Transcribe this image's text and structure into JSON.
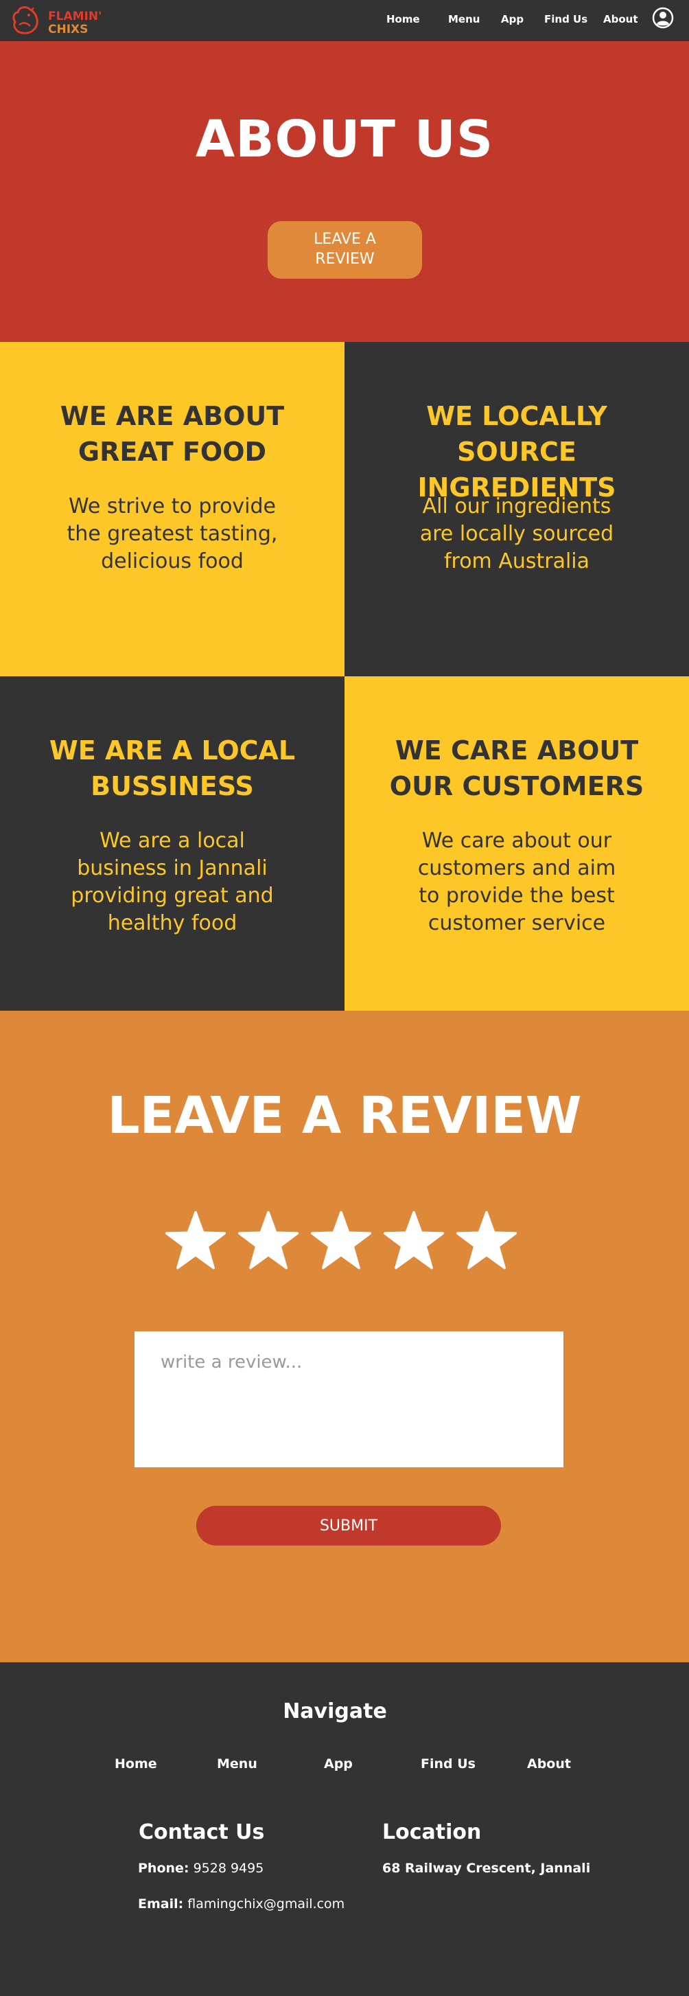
{
  "header": {
    "logo_line1": "FLAMIN'",
    "logo_line2": "CHIXS",
    "nav": [
      "Home",
      "Menu",
      "App",
      "Find Us",
      "About"
    ],
    "user_icon": "user-circle-icon"
  },
  "hero": {
    "title": "ABOUT US",
    "button": "LEAVE A\nREVIEW"
  },
  "features": [
    {
      "title": "WE ARE ABOUT GREAT FOOD",
      "text": "We strive to provide the greatest tasting, delicious food"
    },
    {
      "title": "WE LOCALLY SOURCE INGREDIENTS",
      "text": "All our ingredients are locally sourced from Australia"
    },
    {
      "title": "WE ARE A LOCAL BUSSINESS",
      "text": "We are a local business in Jannali providing great and healthy food"
    },
    {
      "title": "WE CARE ABOUT OUR CUSTOMERS",
      "text": "We care about our customers and aim to provide the best customer service"
    }
  ],
  "review": {
    "title": "LEAVE A REVIEW",
    "star_count": 5,
    "placeholder": "write a review...",
    "submit": "SUBMIT"
  },
  "footer": {
    "navigate_title": "Navigate",
    "nav": [
      "Home",
      "Menu",
      "App",
      "Find Us",
      "About"
    ],
    "contact_title": "Contact Us",
    "phone_label": "Phone:",
    "phone": "9528 9495",
    "email_label": "Email:",
    "email": "flamingchix@gmail.com",
    "location_title": "Location",
    "address": "68 Railway Crescent, Jannali"
  },
  "colors": {
    "dark": "#333333",
    "red": "#c0392b",
    "orange": "#de883a",
    "yellow": "#fdc727",
    "white": "#ffffff"
  }
}
